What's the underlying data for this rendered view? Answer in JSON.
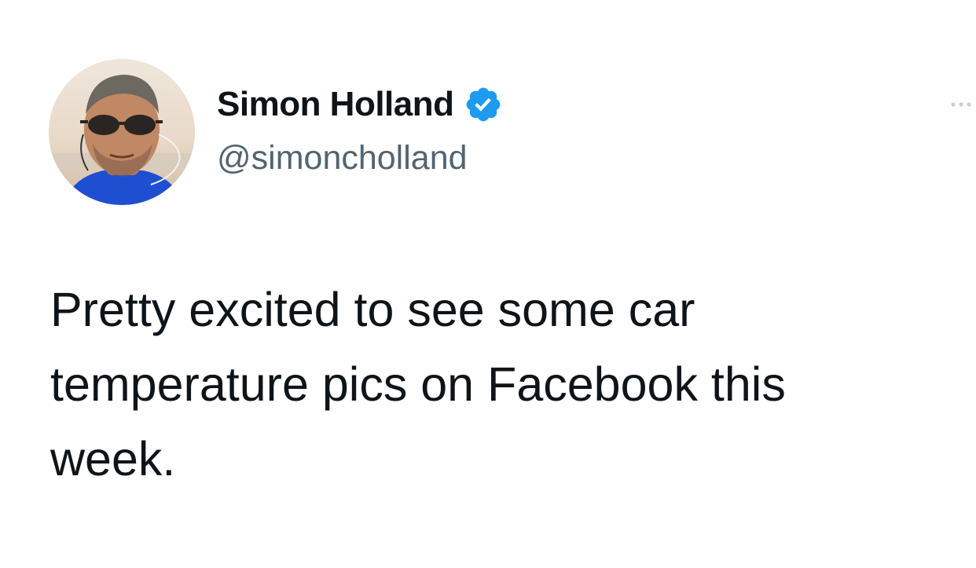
{
  "tweet": {
    "author": {
      "display_name": "Simon Holland",
      "handle": "@simoncholland",
      "verified": true,
      "avatar_icon": "profile-photo"
    },
    "text_lines": [
      "Pretty excited to see some car",
      "temperature pics on Facebook this",
      "week."
    ],
    "more_icon": "more-options-icon"
  },
  "colors": {
    "text": "#0f1419",
    "secondary_text": "#536471",
    "verified_blue": "#1d9bf0",
    "background": "#ffffff"
  }
}
